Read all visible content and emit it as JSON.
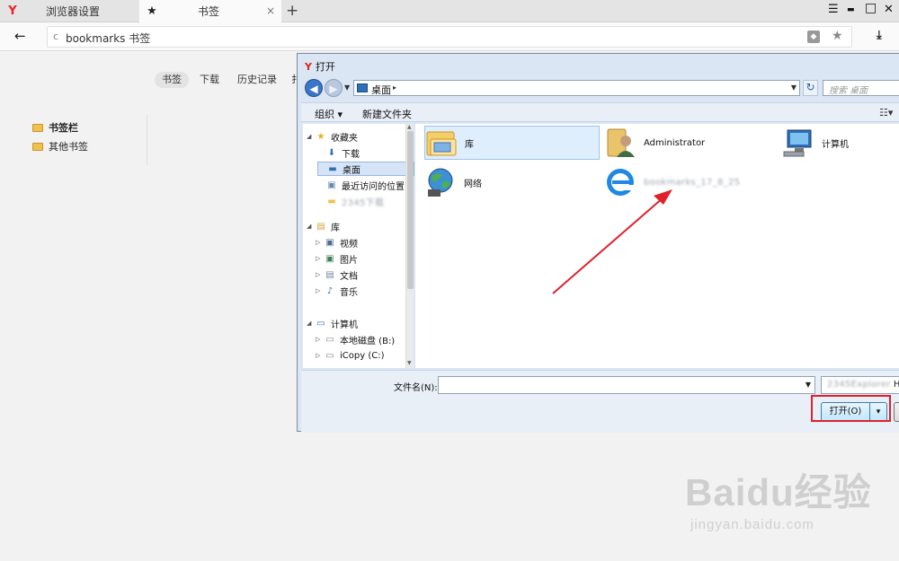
{
  "browser": {
    "tabs": [
      {
        "icon": "Y",
        "label": "浏览器设置",
        "close": "×"
      },
      {
        "icon": "★",
        "label": "书签",
        "close": "×"
      }
    ],
    "new_tab": "+",
    "window_controls": {
      "menu": "☰",
      "minimize": "▬",
      "maximize": "□",
      "close": "✕"
    },
    "back": "←",
    "address": {
      "reload": "c",
      "url": "bookmarks 书签"
    },
    "download": "⤓"
  },
  "bookmarks_page": {
    "nav": [
      "书签",
      "下载",
      "历史记录",
      "扌"
    ],
    "active_nav": 0,
    "folders": [
      "书签栏",
      "其他书签"
    ]
  },
  "dialog": {
    "title_icon": "Y",
    "title": "打开",
    "path": "桌面",
    "path_arrow": "▸",
    "search_placeholder": "搜索 桌面",
    "toolbar": {
      "organize": "组织 ▾",
      "new_folder": "新建文件夹",
      "view": "☷▾"
    },
    "nav_pane": [
      {
        "label": "收藏夹",
        "expander": "◢",
        "icon": "★",
        "icon_color": "#e3b21a"
      },
      {
        "label": "下载",
        "expander": "",
        "icon": "⬇",
        "icon_color": "#2f6fb6"
      },
      {
        "label": "桌面",
        "expander": "",
        "icon": "▬",
        "icon_color": "#2f6fb6",
        "selected": true
      },
      {
        "label": "最近访问的位置",
        "expander": "",
        "icon": "▣",
        "icon_color": "#6b88b0"
      },
      {
        "label": "2345下载",
        "expander": "",
        "icon": "▬",
        "icon_color": "#f2c04d",
        "blurred": true
      },
      {
        "label": "库",
        "expander": "◢",
        "icon": "▤",
        "icon_color": "#d9a23b"
      },
      {
        "label": "视频",
        "expander": "▷",
        "icon": "▣",
        "icon_color": "#4a6a93"
      },
      {
        "label": "图片",
        "expander": "▷",
        "icon": "▣",
        "icon_color": "#3b7d4f"
      },
      {
        "label": "文档",
        "expander": "▷",
        "icon": "▤",
        "icon_color": "#6f86a8"
      },
      {
        "label": "音乐",
        "expander": "▷",
        "icon": "♪",
        "icon_color": "#2f6fb6"
      },
      {
        "label": "计算机",
        "expander": "◢",
        "icon": "▭",
        "icon_color": "#2f6fb6"
      },
      {
        "label": "本地磁盘 (B:)",
        "expander": "▷",
        "icon": "▭",
        "icon_color": "#888888"
      },
      {
        "label": "iCopy (C:)",
        "expander": "▷",
        "icon": "▭",
        "icon_color": "#888888"
      }
    ],
    "files": [
      {
        "label": "库",
        "type": "library",
        "selected": true
      },
      {
        "label": "Administrator",
        "type": "user"
      },
      {
        "label": "计算机",
        "type": "computer"
      },
      {
        "label": "网络",
        "type": "network"
      },
      {
        "label": "bookmarks_17_8_25",
        "type": "ie-html",
        "blurred": true
      }
    ],
    "filename_label": "文件名(N):",
    "filename_value": "",
    "file_type": "HTML",
    "file_type_blurred_prefix": "2345Explorer",
    "open_button": "打开(O)",
    "open_arrow": "▾"
  },
  "watermark": {
    "main": "Baidu经验",
    "sub": "jingyan.baidu.com"
  },
  "colors": {
    "annotation": "#e0202a",
    "accent": "#3a76c8"
  }
}
